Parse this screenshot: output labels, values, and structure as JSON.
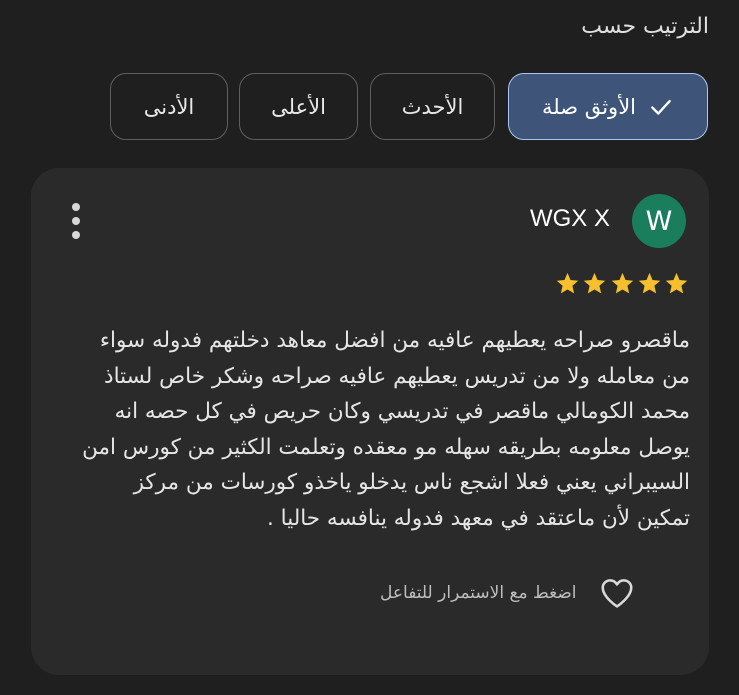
{
  "sort": {
    "title": "الترتيب حسب",
    "chips": [
      {
        "label": "الأوثق صلة",
        "selected": true
      },
      {
        "label": "الأحدث",
        "selected": false
      },
      {
        "label": "الأعلى",
        "selected": false
      },
      {
        "label": "الأدنى",
        "selected": false
      }
    ]
  },
  "review": {
    "avatar_letter": "W",
    "avatar_color": "#1a7d5c",
    "reviewer_name": "WGX X",
    "rating": 5,
    "star_color": "#f5c02c",
    "text": "ماقصرو صراحه يعطيهم عافيه من افضل معاهد دخلتهم فدوله سواء\nمن معامله ولا من تدريس يعطيهم عافيه صراحه وشكر خاص لستاذ\nمحمد الكومالي ماقصر في تدريسي وكان حريص في كل حصه انه\nيوصل معلومه بطريقه سهله مو معقده وتعلمت الكثير من كورس امن\nالسيبراني يعني فعلا اشجع ناس يدخلو ياخذو كورسات من مركز\nتمكين لأن ماعتقد في معهد فدوله ينافسه حاليا .",
    "react_label": "اضغط مع الاستمرار للتفاعل"
  },
  "icons": {
    "check": "check-icon",
    "more": "more-vert-icon",
    "star": "star-icon",
    "heart": "heart-outline-icon"
  },
  "colors": {
    "background": "#1f1f1f",
    "card": "#2a2a2a",
    "selected_chip_bg": "#3e5478",
    "selected_chip_border": "#a9c6f3"
  }
}
